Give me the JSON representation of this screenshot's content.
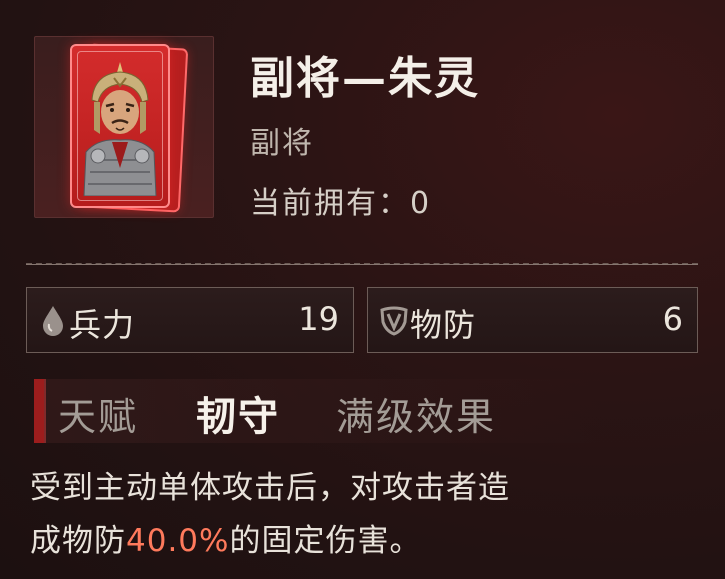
{
  "card": {
    "title": "副将—朱灵",
    "type": "副将",
    "owned_label": "当前拥有：",
    "owned_count": "0",
    "colors": {
      "card_red": "#c92323",
      "card_border": "#ff8a8a"
    }
  },
  "stats": [
    {
      "icon": "blood-drop-icon",
      "label": "兵力",
      "value": "19"
    },
    {
      "icon": "shield-icon",
      "label": "物防",
      "value": "6"
    }
  ],
  "talent": {
    "label": "天赋",
    "name": "韧守",
    "max_effect_label": "满级效果"
  },
  "description": {
    "line1": "受到主动单体攻击后，对攻击者造",
    "line2_prefix": "成物防",
    "highlight": "40.0%",
    "line2_suffix": "的固定伤害。",
    "highlight_color": "#ff7a5c"
  }
}
